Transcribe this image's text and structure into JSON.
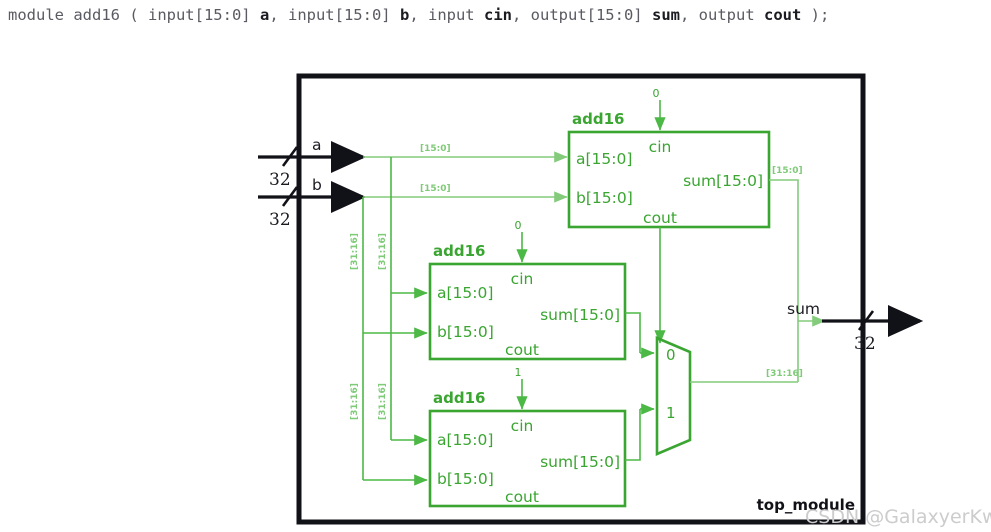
{
  "code_header": {
    "tokens": [
      {
        "t": "module add16 ( ",
        "c": "kw"
      },
      {
        "t": "input[15:0] ",
        "c": "kw"
      },
      {
        "t": "a",
        "c": "id"
      },
      {
        "t": ", ",
        "c": "punc"
      },
      {
        "t": "input[15:0] ",
        "c": "kw"
      },
      {
        "t": "b",
        "c": "id"
      },
      {
        "t": ", ",
        "c": "punc"
      },
      {
        "t": "input ",
        "c": "kw"
      },
      {
        "t": "cin",
        "c": "id"
      },
      {
        "t": ", ",
        "c": "punc"
      },
      {
        "t": "output[15:0] ",
        "c": "kw"
      },
      {
        "t": "sum",
        "c": "id"
      },
      {
        "t": ", ",
        "c": "punc"
      },
      {
        "t": "output ",
        "c": "kw"
      },
      {
        "t": "cout",
        "c": "id"
      },
      {
        "t": " );",
        "c": "punc"
      }
    ],
    "full_text": "module add16 ( input[15:0] a, input[15:0] b, input cin, output[15:0] sum, output cout );"
  },
  "diagram": {
    "module_name": "top_module",
    "watermark": "CSDN @GalaxyerKw",
    "colors": {
      "green": "#3aa531",
      "green_wire": "#4cb845",
      "green_light": "#84cc7c",
      "black": "#111118",
      "watermark": "#cccccc"
    },
    "inputs": [
      {
        "name": "a",
        "width": "32"
      },
      {
        "name": "b",
        "width": "32"
      }
    ],
    "outputs": [
      {
        "name": "sum",
        "width": "32"
      }
    ],
    "adders": [
      {
        "id": "adder-top",
        "title": "add16",
        "cin_const": "0",
        "ports": {
          "cin": "cin",
          "a": "a[15:0]",
          "b": "b[15:0]",
          "sum": "sum[15:0]",
          "cout": "cout"
        }
      },
      {
        "id": "adder-middle",
        "title": "add16",
        "cin_const": "0",
        "ports": {
          "cin": "cin",
          "a": "a[15:0]",
          "b": "b[15:0]",
          "sum": "sum[15:0]",
          "cout": "cout"
        }
      },
      {
        "id": "adder-bottom",
        "title": "add16",
        "cin_const": "1",
        "ports": {
          "cin": "cin",
          "a": "a[15:0]",
          "b": "b[15:0]",
          "sum": "sum[15:0]",
          "cout": "cout"
        }
      }
    ],
    "mux": {
      "input_0_label": "0",
      "input_1_label": "1"
    },
    "bus_labels": {
      "a_low": "[15:0]",
      "b_low": "[15:0]",
      "sum_low": "[15:0]",
      "a_high_mid": "[31:16]",
      "b_high_mid": "[31:16]",
      "a_high_bot": "[31:16]",
      "b_high_bot": "[31:16]",
      "sum_high": "[31:16]"
    }
  }
}
